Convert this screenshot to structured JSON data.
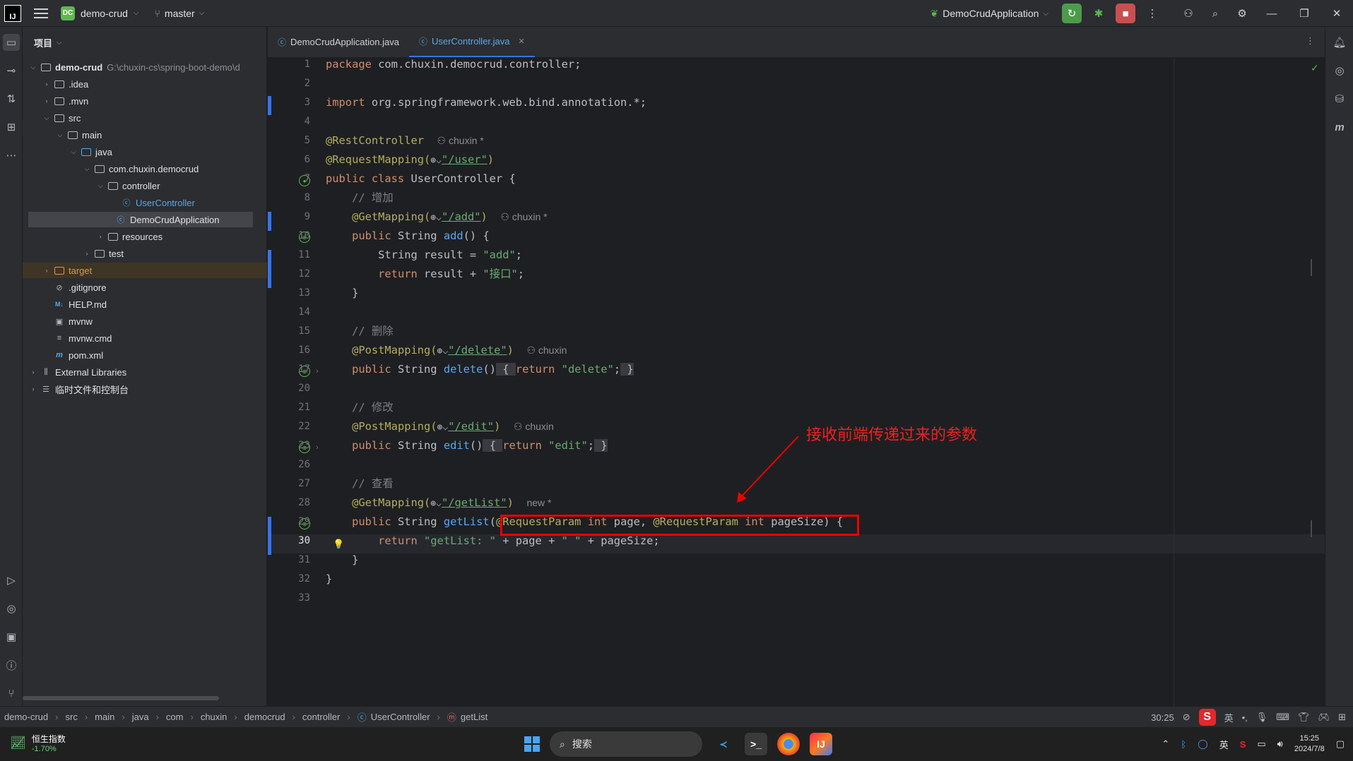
{
  "titlebar": {
    "logo": "IJ",
    "project_badge": "DC",
    "project_name": "demo-crud",
    "branch": "master",
    "run_config": "DemoCrudApplication",
    "icons": [
      "menu-icon",
      "branch-icon",
      "run-icon",
      "debug-icon",
      "stop-icon",
      "more-icon",
      "user-add-icon",
      "search-icon",
      "settings-icon"
    ]
  },
  "project_panel": {
    "header": "项目",
    "tree": [
      {
        "label": "demo-crud",
        "extra": "G:\\chuxin-cs\\spring-boot-demo\\d",
        "icon": "folder"
      },
      {
        "label": ".idea",
        "icon": "folder"
      },
      {
        "label": ".mvn",
        "icon": "folder"
      },
      {
        "label": "src",
        "icon": "folder"
      },
      {
        "label": "main",
        "icon": "folder"
      },
      {
        "label": "java",
        "icon": "folder"
      },
      {
        "label": "com.chuxin.democrud",
        "icon": "package"
      },
      {
        "label": "controller",
        "icon": "package"
      },
      {
        "label": "UserController",
        "icon": "class"
      },
      {
        "label": "DemoCrudApplication",
        "icon": "class"
      },
      {
        "label": "resources",
        "icon": "folder"
      },
      {
        "label": "test",
        "icon": "folder"
      },
      {
        "label": "target",
        "icon": "folder"
      },
      {
        "label": ".gitignore",
        "icon": "gitignore"
      },
      {
        "label": "HELP.md",
        "icon": "markdown"
      },
      {
        "label": "mvnw",
        "icon": "terminal"
      },
      {
        "label": "mvnw.cmd",
        "icon": "file"
      },
      {
        "label": "pom.xml",
        "icon": "maven"
      },
      {
        "label": "External Libraries",
        "icon": "library"
      },
      {
        "label": "临时文件和控制台",
        "icon": "scratch"
      }
    ]
  },
  "tabs": [
    {
      "label": "DemoCrudApplication.java",
      "active": false
    },
    {
      "label": "UserController.java",
      "active": true
    }
  ],
  "editor": {
    "line_numbers": [
      "1",
      "2",
      "3",
      "4",
      "5",
      "6",
      "7",
      "8",
      "9",
      "10",
      "11",
      "12",
      "13",
      "14",
      "15",
      "16",
      "17",
      "20",
      "21",
      "22",
      "23",
      "26",
      "27",
      "28",
      "29",
      "30",
      "31",
      "32",
      "33"
    ],
    "current_line": "30",
    "code": {
      "l1_kw": "package",
      "l1_rest": " com.chuxin.democrud.controller;",
      "l3_kw": "import",
      "l3_rest": " org.springframework.web.bind.annotation.*;",
      "l5_an": "@RestController",
      "l5_hint": "chuxin *",
      "l6_an": "@RequestMapping(",
      "l6_str": "\"/user\"",
      "l6_end": ")",
      "l7_kw": "public class",
      "l7_rest": " UserController {",
      "l8_cm": "// 增加",
      "l9_an": "@GetMapping(",
      "l9_str": "\"/add\"",
      "l9_end": ")",
      "l9_hint": "chuxin *",
      "l10_kw": "public",
      "l10_mid": " String ",
      "l10_fn": "add",
      "l10_end": "() {",
      "l11_a": "String result = ",
      "l11_str": "\"add\"",
      "l11_end": ";",
      "l12_kw": "return",
      "l12_a": " result + ",
      "l12_str": "\"接口\"",
      "l12_end": ";",
      "l13": "}",
      "l15_cm": "// 删除",
      "l16_an": "@PostMapping(",
      "l16_str": "\"/delete\"",
      "l16_end": ")",
      "l16_hint": "chuxin",
      "l17_kw": "public",
      "l17_mid": " String ",
      "l17_fn": "delete",
      "l17_end": "()",
      "l17_f1": " { ",
      "l17_kw2": "return",
      "l17_str": " \"delete\"",
      "l17_semi": ";",
      "l17_f2": " }",
      "l21_cm": "// 修改",
      "l22_an": "@PostMapping(",
      "l22_str": "\"/edit\"",
      "l22_end": ")",
      "l22_hint": "chuxin",
      "l23_kw": "public",
      "l23_mid": " String ",
      "l23_fn": "edit",
      "l23_end": "()",
      "l23_f1": " { ",
      "l23_kw2": "return",
      "l23_str": " \"edit\"",
      "l23_semi": ";",
      "l23_f2": " }",
      "l27_cm": "// 查看",
      "l28_an": "@GetMapping(",
      "l28_str": "\"/getList\"",
      "l28_end": ")",
      "l28_hint": "new *",
      "l29_kw": "public",
      "l29_mid": " String ",
      "l29_fn": "getList",
      "l29_p1": "(",
      "l29_an1": "@RequestParam",
      "l29_kw1": " int",
      "l29_a": " page, ",
      "l29_an2": "@RequestParam",
      "l29_kw2": " int",
      "l29_b": " pageSize)",
      "l29_end": " {",
      "l30_kw": "return",
      "l30_str1": " \"getList: \"",
      "l30_a": " + page + ",
      "l30_str2": "\" \"",
      "l30_b": " + pageSize;",
      "l31": "}",
      "l32": "}"
    },
    "annotation": "接收前端传递过来的参数"
  },
  "statusbar": {
    "breadcrumb": [
      "demo-crud",
      "src",
      "main",
      "java",
      "com",
      "chuxin",
      "democrud",
      "controller",
      "UserController",
      "getList"
    ],
    "position": "30:25",
    "ime": [
      "S",
      "英"
    ]
  },
  "taskbar": {
    "stock_name": "恒生指数",
    "stock_change": "-1.70%",
    "search_placeholder": "搜索",
    "lang": "英",
    "time": "15:25",
    "date": "2024/7/8"
  },
  "colors": {
    "accent": "#3574f0",
    "annotation_red": "#ee0000",
    "run_green": "#4e9a4d",
    "stop_red": "#c94f4f"
  }
}
